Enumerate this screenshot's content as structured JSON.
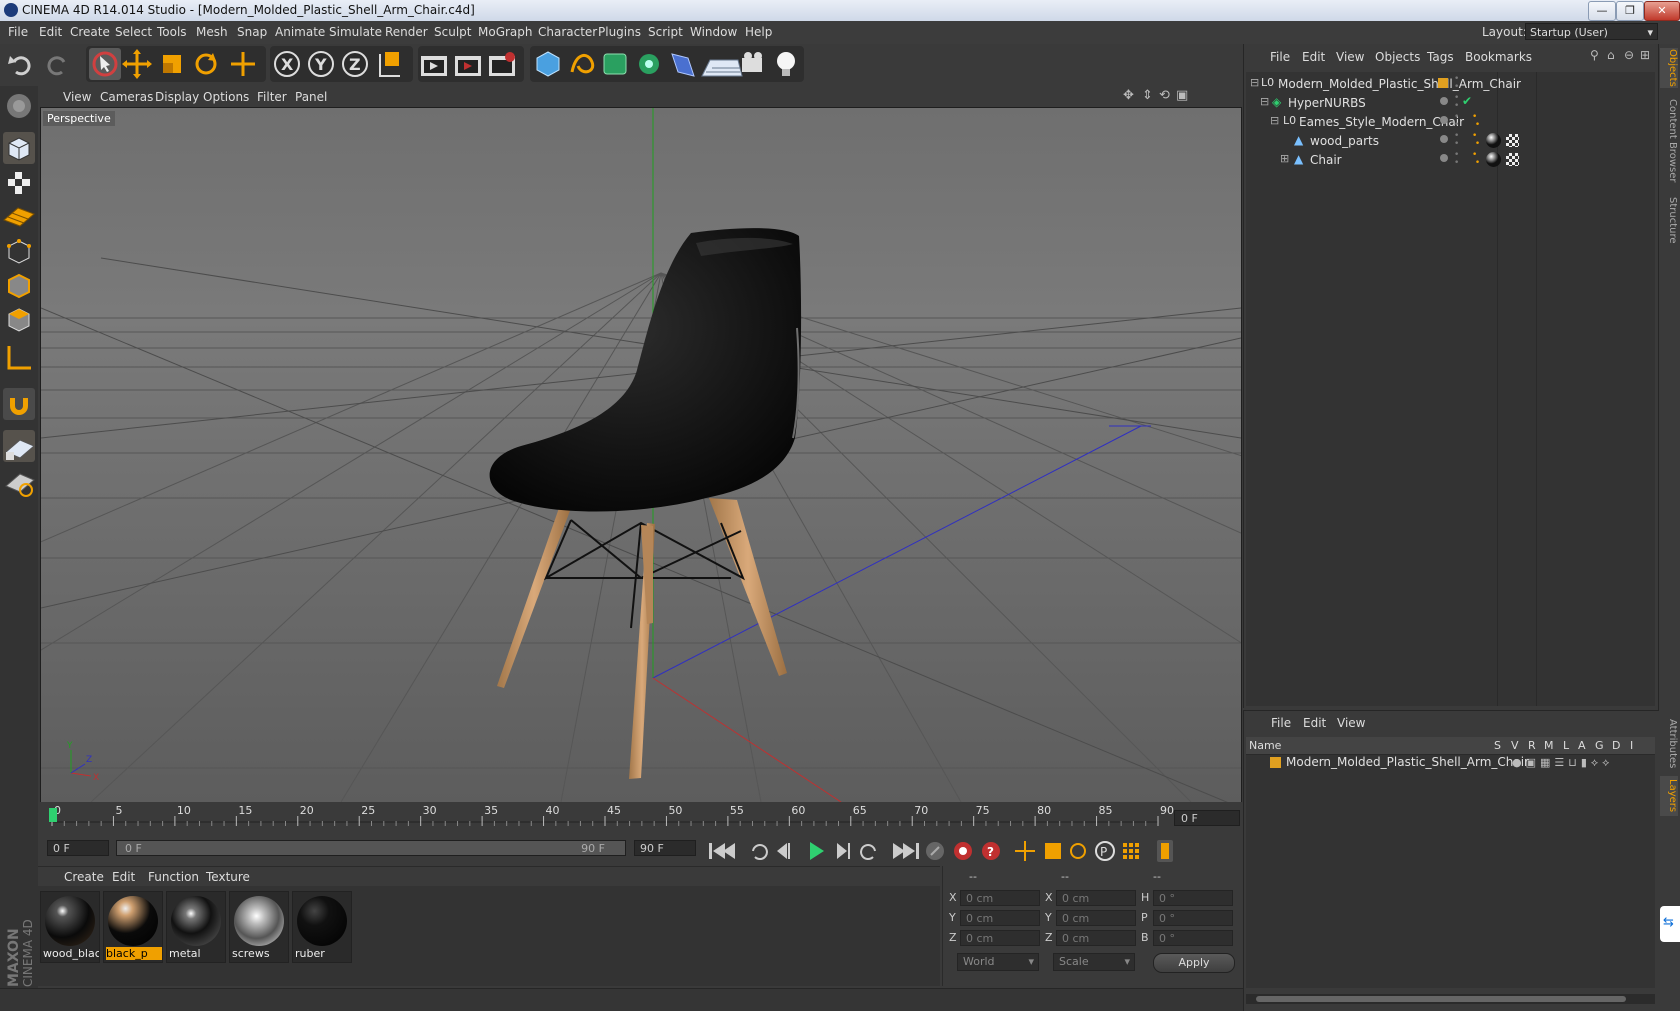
{
  "window": {
    "title": "CINEMA 4D R14.014 Studio - [Modern_Molded_Plastic_Shell_Arm_Chair.c4d]",
    "controls": [
      "minimize",
      "maximize",
      "close"
    ]
  },
  "menubar": {
    "items": [
      "File",
      "Edit",
      "Create",
      "Select",
      "Tools",
      "Mesh",
      "Snap",
      "Animate",
      "Simulate",
      "Render",
      "Sculpt",
      "MoGraph",
      "Character",
      "Plugins",
      "Script",
      "Window",
      "Help"
    ],
    "layout_label": "Layout:",
    "layout_value": "Startup (User)"
  },
  "toolbar": {
    "icons": [
      "undo-icon",
      "redo-icon",
      "live-selection-icon",
      "move-icon",
      "scale-icon",
      "rotate-icon",
      "add-icon",
      "x-axis-icon",
      "y-axis-icon",
      "z-axis-icon",
      "coordinate-system-icon",
      "render-view-icon",
      "render-picture-viewer-icon",
      "render-settings-icon",
      "cube-icon",
      "spline-icon",
      "nurbs-icon",
      "array-icon",
      "deformer-icon",
      "floor-icon",
      "camera-icon",
      "light-icon"
    ],
    "axis_labels": [
      "X",
      "Y",
      "Z"
    ]
  },
  "left_tools": [
    "make-editable-icon",
    "model-mode-icon",
    "texture-mode-icon",
    "workplane-icon",
    "points-mode-icon",
    "edges-mode-icon",
    "polygons-mode-icon",
    "axis-mode-icon",
    "snap-icon",
    "grid-lock-icon",
    "soft-selection-icon"
  ],
  "viewport": {
    "menu": [
      "View",
      "Cameras",
      "Display",
      "Options",
      "Filter",
      "Panel"
    ],
    "camera_label": "Perspective"
  },
  "timeline": {
    "ticks": [
      "0",
      "5",
      "10",
      "15",
      "20",
      "25",
      "30",
      "35",
      "40",
      "45",
      "50",
      "55",
      "60",
      "65",
      "70",
      "75",
      "80",
      "85",
      "90"
    ],
    "current_frame": "0 F"
  },
  "transport": {
    "start_field": "0 F",
    "range_start": "0 F",
    "range_end": "90 F",
    "end_field": "90 F"
  },
  "materials": {
    "menu": [
      "Create",
      "Edit",
      "Function",
      "Texture"
    ],
    "items": [
      {
        "label": "wood_blac",
        "selected": false
      },
      {
        "label": "black_p",
        "selected": true
      },
      {
        "label": "metal",
        "selected": false
      },
      {
        "label": "screws",
        "selected": false
      },
      {
        "label": "ruber",
        "selected": false
      }
    ]
  },
  "coordinates": {
    "headers": [
      "--",
      "--",
      "--"
    ],
    "rows": [
      {
        "a": "X",
        "av": "0 cm",
        "b": "X",
        "bv": "0 cm",
        "c": "H",
        "cv": "0 °"
      },
      {
        "a": "Y",
        "av": "0 cm",
        "b": "Y",
        "bv": "0 cm",
        "c": "P",
        "cv": "0 °"
      },
      {
        "a": "Z",
        "av": "0 cm",
        "b": "Z",
        "bv": "0 cm",
        "c": "B",
        "cv": "0 °"
      }
    ],
    "mode_select": "World",
    "size_select": "Scale",
    "apply_label": "Apply"
  },
  "object_manager": {
    "menu": [
      "File",
      "Edit",
      "View",
      "Objects",
      "Tags",
      "Bookmarks"
    ],
    "objects": [
      {
        "name": "Modern_Molded_Plastic_Shell_Arm_Chair",
        "indent": 0
      },
      {
        "name": "HyperNURBS",
        "indent": 1
      },
      {
        "name": "Eames_Style_Modern_Chair",
        "indent": 2
      },
      {
        "name": "wood_parts",
        "indent": 3
      },
      {
        "name": "Chair",
        "indent": 3
      }
    ]
  },
  "side_tabs": [
    "Objects",
    "Content Browser",
    "Structure",
    "Attributes",
    "Layers"
  ],
  "layer_manager": {
    "menu": [
      "File",
      "Edit",
      "View"
    ],
    "columns": [
      "Name",
      "S",
      "V",
      "R",
      "M",
      "L",
      "A",
      "G",
      "D",
      "I"
    ],
    "layers": [
      {
        "name": "Modern_Molded_Plastic_Shell_Arm_Chair",
        "color": "#e0a020"
      }
    ]
  },
  "branding": {
    "logo_text": "MAXON CINEMA 4D"
  },
  "colors": {
    "accent": "#f0a000",
    "bg": "#3a3a3a",
    "x_axis": "#c03030",
    "y_axis": "#20a020",
    "z_axis": "#3030c0"
  }
}
